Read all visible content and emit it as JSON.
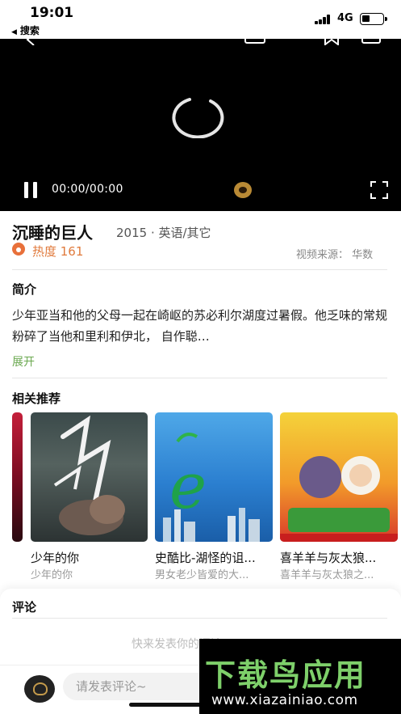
{
  "status_bar": {
    "time": "19:01",
    "back_label": "搜索",
    "network": "4G"
  },
  "player": {
    "time_display": "00:00/00:00",
    "progress": 0
  },
  "video_info": {
    "title": "沉睡的巨人",
    "meta": "2015 · 英语/其它",
    "heat": "热度 161",
    "source": "视频来源： 华数"
  },
  "synopsis": {
    "heading": "简介",
    "text": "少年亚当和他的父母一起在崎岖的苏必利尔湖度过暑假。他乏味的常规粉碎了当他和里利和伊北， 自作聪…",
    "expand_label": "展开"
  },
  "recommendations": {
    "heading": "相关推荐",
    "items": [
      {
        "title": "少年的你",
        "subtitle": "少年的你"
      },
      {
        "title": "史酷比-湖怪的诅...",
        "subtitle": "男女老少皆爱的大..."
      },
      {
        "title": "喜羊羊与灰太狼...",
        "subtitle": "喜羊羊与灰太狼之..."
      }
    ]
  },
  "comments": {
    "heading": "评论",
    "empty_text": "快来发表你的评论吧",
    "input_placeholder": "请发表评论~"
  },
  "watermark": {
    "name": "下载鸟应用",
    "url": "www.xiazainiao.com"
  },
  "colors": {
    "accent_green": "#6aa84f",
    "heat_orange": "#e07a3c",
    "video_bg": "#000000"
  },
  "icons": [
    "back-icon",
    "signal-icon",
    "battery-icon",
    "loading-spinner-icon",
    "pause-icon",
    "progress-knob-icon",
    "fullscreen-icon",
    "fire-icon",
    "avatar-icon"
  ]
}
